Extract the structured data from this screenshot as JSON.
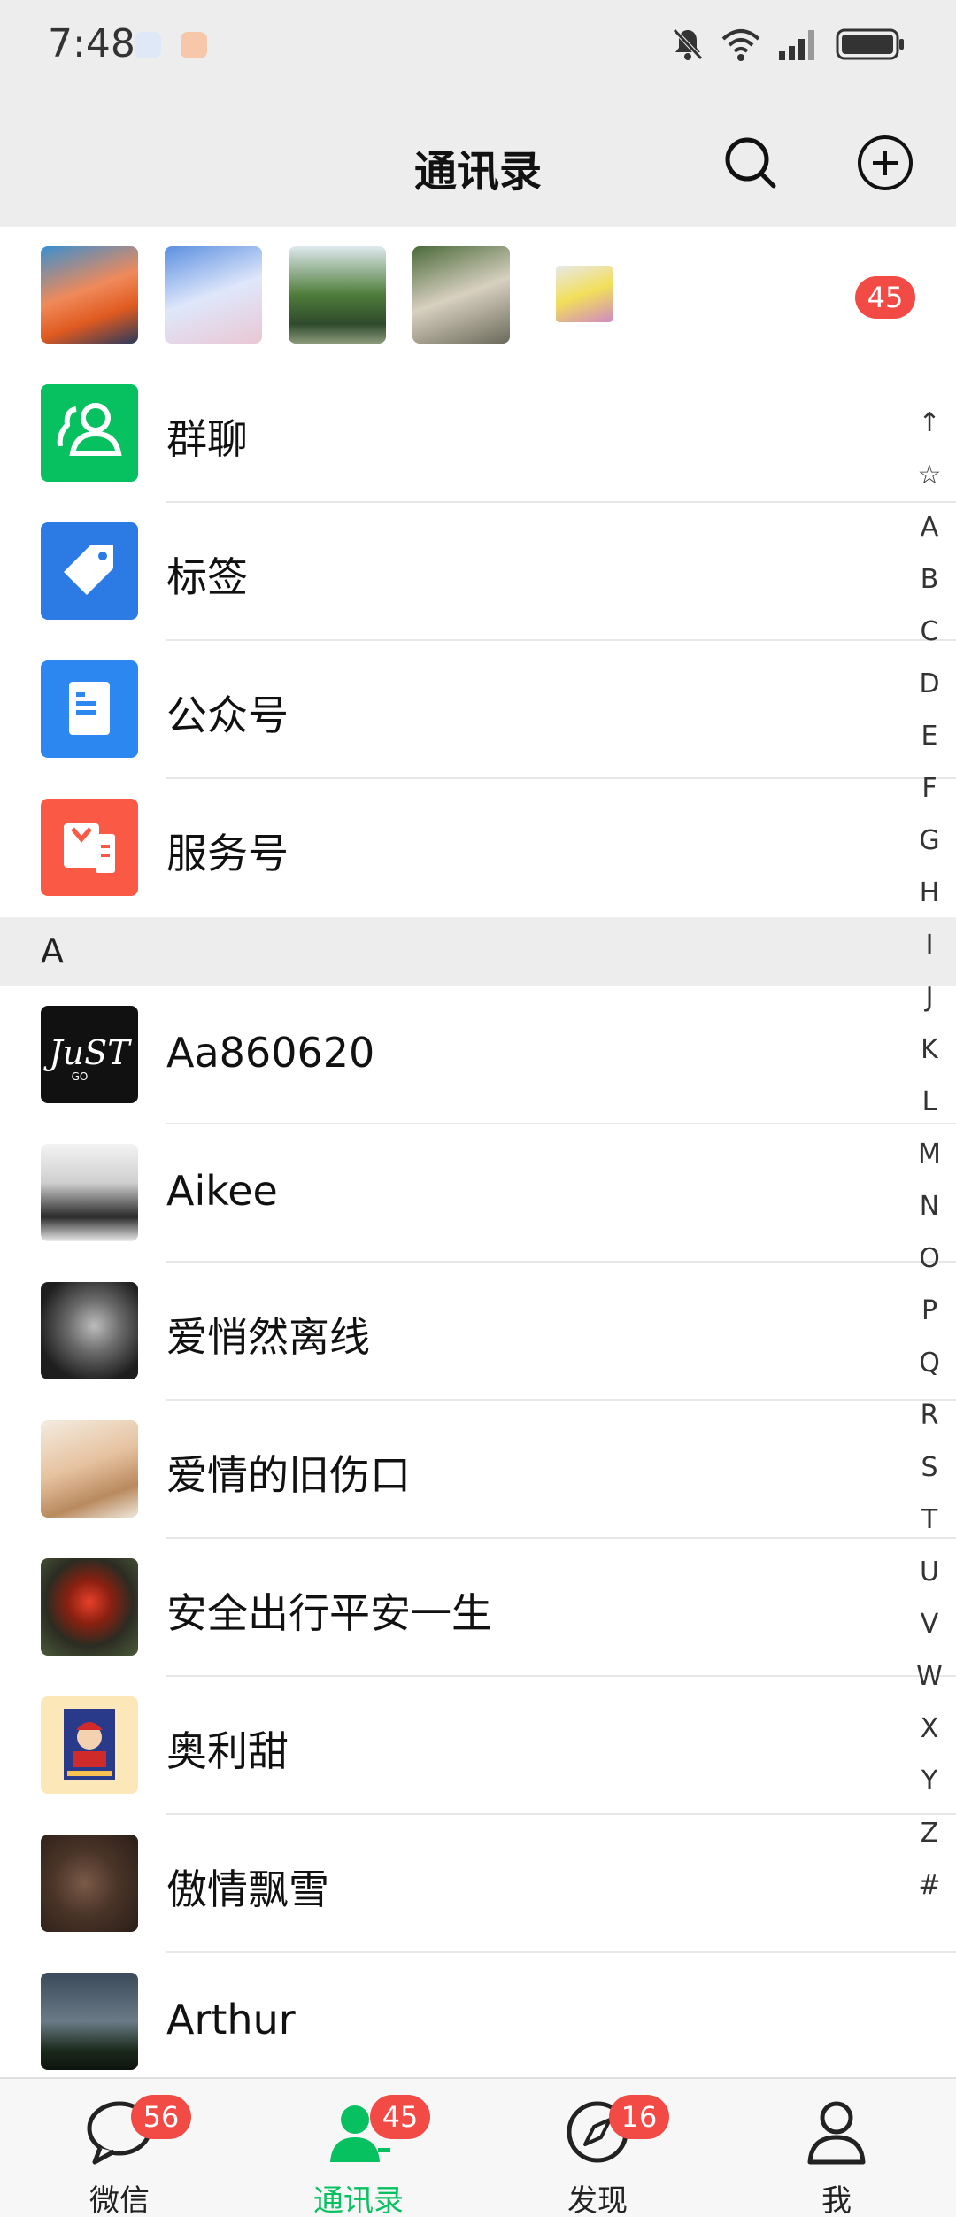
{
  "status_bar": {
    "time": "7:48",
    "battery_percent": 100,
    "icons": [
      "mute-bell-icon",
      "wifi-icon",
      "signal-icon",
      "battery-icon"
    ]
  },
  "header": {
    "title": "通讯录",
    "icons": [
      "search-icon",
      "add-circle-icon"
    ]
  },
  "recent": {
    "badge": "45"
  },
  "entries": [
    {
      "label": "群聊",
      "color": "#07c160",
      "icon": "group-chat-icon"
    },
    {
      "label": "标签",
      "color": "#2c7be5",
      "icon": "tag-icon"
    },
    {
      "label": "公众号",
      "color": "#2c87f0",
      "icon": "official-account-icon"
    },
    {
      "label": "服务号",
      "color": "#fa5a45",
      "icon": "service-account-icon"
    }
  ],
  "section": {
    "letter": "A"
  },
  "contacts": [
    {
      "name": "Aa860620"
    },
    {
      "name": "Aikee"
    },
    {
      "name": "爱悄然离线"
    },
    {
      "name": "爱情的旧伤口"
    },
    {
      "name": "安全出行平安一生"
    },
    {
      "name": "奥利甜"
    },
    {
      "name": "傲情飘雪"
    },
    {
      "name": "Arthur"
    }
  ],
  "alpha_index": [
    "↑",
    "☆",
    "A",
    "B",
    "C",
    "D",
    "E",
    "F",
    "G",
    "H",
    "I",
    "J",
    "K",
    "L",
    "M",
    "N",
    "O",
    "P",
    "Q",
    "R",
    "S",
    "T",
    "U",
    "V",
    "W",
    "X",
    "Y",
    "Z",
    "#"
  ],
  "tabs": [
    {
      "label": "微信",
      "badge": "56",
      "icon": "chat-bubble-icon"
    },
    {
      "label": "通讯录",
      "badge": "45",
      "icon": "contacts-icon",
      "active": true
    },
    {
      "label": "发现",
      "badge": "16",
      "icon": "compass-icon"
    },
    {
      "label": "我",
      "badge": "",
      "icon": "person-icon"
    }
  ],
  "accent_color": "#07c160",
  "badge_color": "#f24a45"
}
